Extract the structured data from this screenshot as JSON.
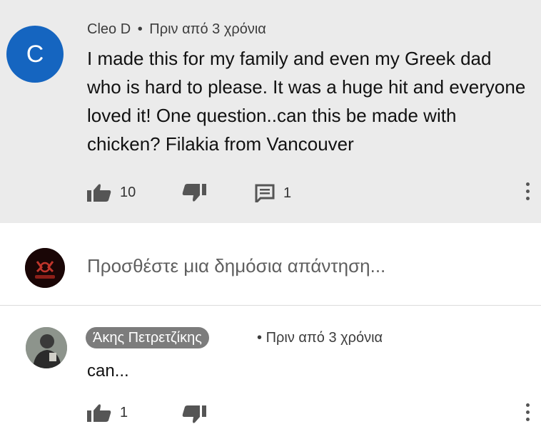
{
  "comment": {
    "avatar_letter": "C",
    "avatar_color": "#1565c0",
    "author": "Cleo D",
    "separator": "•",
    "time": "Πριν από 3 χρόνια",
    "text": "I made this for my family and even my Greek dad who is hard to please. It was a huge hit and everyone loved it! One question..can this be made with chicken? Filakia from Vancouver",
    "like_icon": "thumbs-up-icon",
    "likes": "10",
    "dislike_icon": "thumbs-down-icon",
    "reply_icon": "comment-icon",
    "replies": "1",
    "more_icon": "more-vert-icon"
  },
  "reply_box": {
    "placeholder": "Προσθέστε μια δημόσια απάντηση..."
  },
  "reply": {
    "author": "Άκης Πετρετζίκης",
    "separator": "•",
    "time": "Πριν από 3 χρόνια",
    "text": "can...",
    "likes": "1"
  }
}
